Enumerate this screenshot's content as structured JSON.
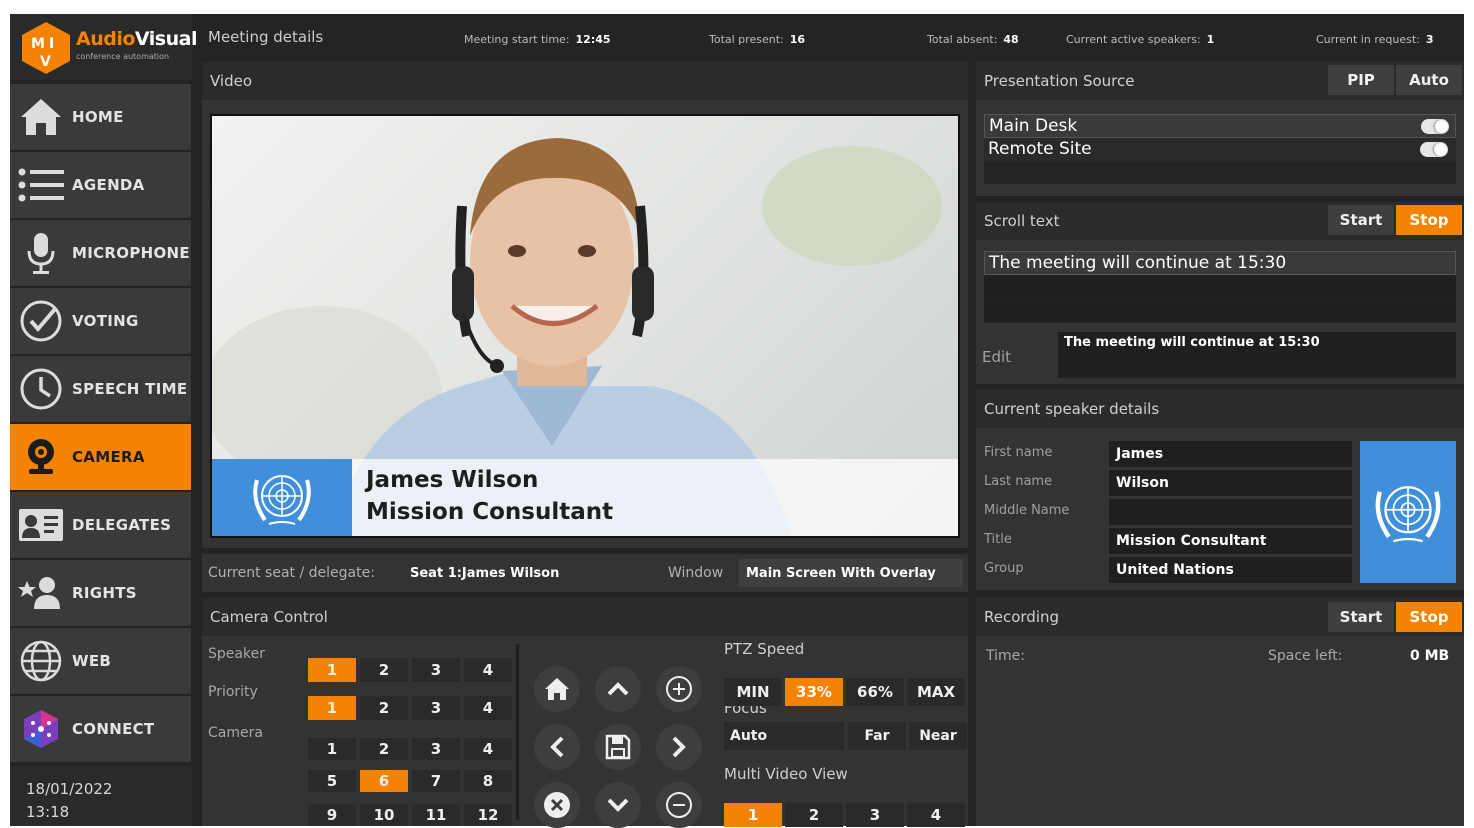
{
  "brand": {
    "name_part1": "Audio",
    "name_part2": "Visual",
    "tagline": "conference automation",
    "logo_text": "MIV"
  },
  "sidebar": {
    "items": [
      {
        "label": "HOME",
        "icon": "home-icon"
      },
      {
        "label": "AGENDA",
        "icon": "list-icon"
      },
      {
        "label": "MICROPHONE",
        "icon": "microphone-icon"
      },
      {
        "label": "VOTING",
        "icon": "check-circle-icon"
      },
      {
        "label": "SPEECH TIME",
        "icon": "clock-icon"
      },
      {
        "label": "CAMERA",
        "icon": "webcam-icon",
        "active": true
      },
      {
        "label": "DELEGATES",
        "icon": "id-card-icon"
      },
      {
        "label": "RIGHTS",
        "icon": "star-user-icon"
      },
      {
        "label": "WEB",
        "icon": "globe-icon"
      },
      {
        "label": "CONNECT",
        "icon": "connect-icon"
      }
    ],
    "date": "18/01/2022",
    "time": "13:18"
  },
  "topbar": {
    "title": "Meeting details",
    "start_label": "Meeting start time:",
    "start_value": "12:45",
    "present_label": "Total present:",
    "present_value": "16",
    "absent_label": "Total absent:",
    "absent_value": "48",
    "speakers_label": "Current active speakers:",
    "speakers_value": "1",
    "request_label": "Current in request:",
    "request_value": "3"
  },
  "video": {
    "title": "Video",
    "overlay_name": "James Wilson",
    "overlay_title": "Mission Consultant",
    "seat_label": "Current seat / delegate:",
    "seat_value": "Seat 1:James Wilson",
    "window_label": "Window",
    "window_value": "Main Screen With Overlay"
  },
  "camera_control": {
    "title": "Camera Control",
    "speaker_label": "Speaker",
    "priority_label": "Priority",
    "camera_label": "Camera",
    "speaker_buttons": [
      "1",
      "2",
      "3",
      "4"
    ],
    "priority_buttons": [
      "1",
      "2",
      "3",
      "4"
    ],
    "camera_buttons": [
      "1",
      "2",
      "3",
      "4",
      "5",
      "6",
      "7",
      "8",
      "9",
      "10",
      "11",
      "12"
    ],
    "speaker_selected": "1",
    "priority_selected": "1",
    "camera_selected": "6",
    "ptz_label": "PTZ Speed",
    "ptz_options": [
      "MIN",
      "33%",
      "66%",
      "MAX"
    ],
    "ptz_selected": "33%",
    "focus_label": "Focus",
    "focus_auto": "Auto",
    "focus_far": "Far",
    "focus_near": "Near",
    "multi_label": "Multi Video View",
    "multi_options": [
      "1",
      "2",
      "3",
      "4"
    ],
    "multi_selected": "1"
  },
  "presentation": {
    "title": "Presentation Source",
    "pip_label": "PIP",
    "auto_label": "Auto",
    "sources": [
      "Main Desk",
      "Remote Site"
    ]
  },
  "scroll_text": {
    "title": "Scroll text",
    "start_label": "Start",
    "stop_label": "Stop",
    "current": "The meeting will continue at 15:30",
    "edit_label": "Edit",
    "edit_value": "The meeting will continue at 15:30"
  },
  "speaker_details": {
    "title": "Current speaker details",
    "first_label": "First name",
    "first_value": "James",
    "last_label": "Last name",
    "last_value": "Wilson",
    "middle_label": "Middle Name",
    "middle_value": "",
    "title_label": "Title",
    "title_value": "Mission Consultant",
    "group_label": "Group",
    "group_value": "United Nations"
  },
  "recording": {
    "title": "Recording",
    "start_label": "Start",
    "stop_label": "Stop",
    "time_label": "Time:",
    "space_label": "Space left:",
    "space_value": "0 MB"
  },
  "colors": {
    "accent": "#f58200",
    "un_blue": "#3f8fdb",
    "panel": "#333333",
    "background": "#242424"
  }
}
